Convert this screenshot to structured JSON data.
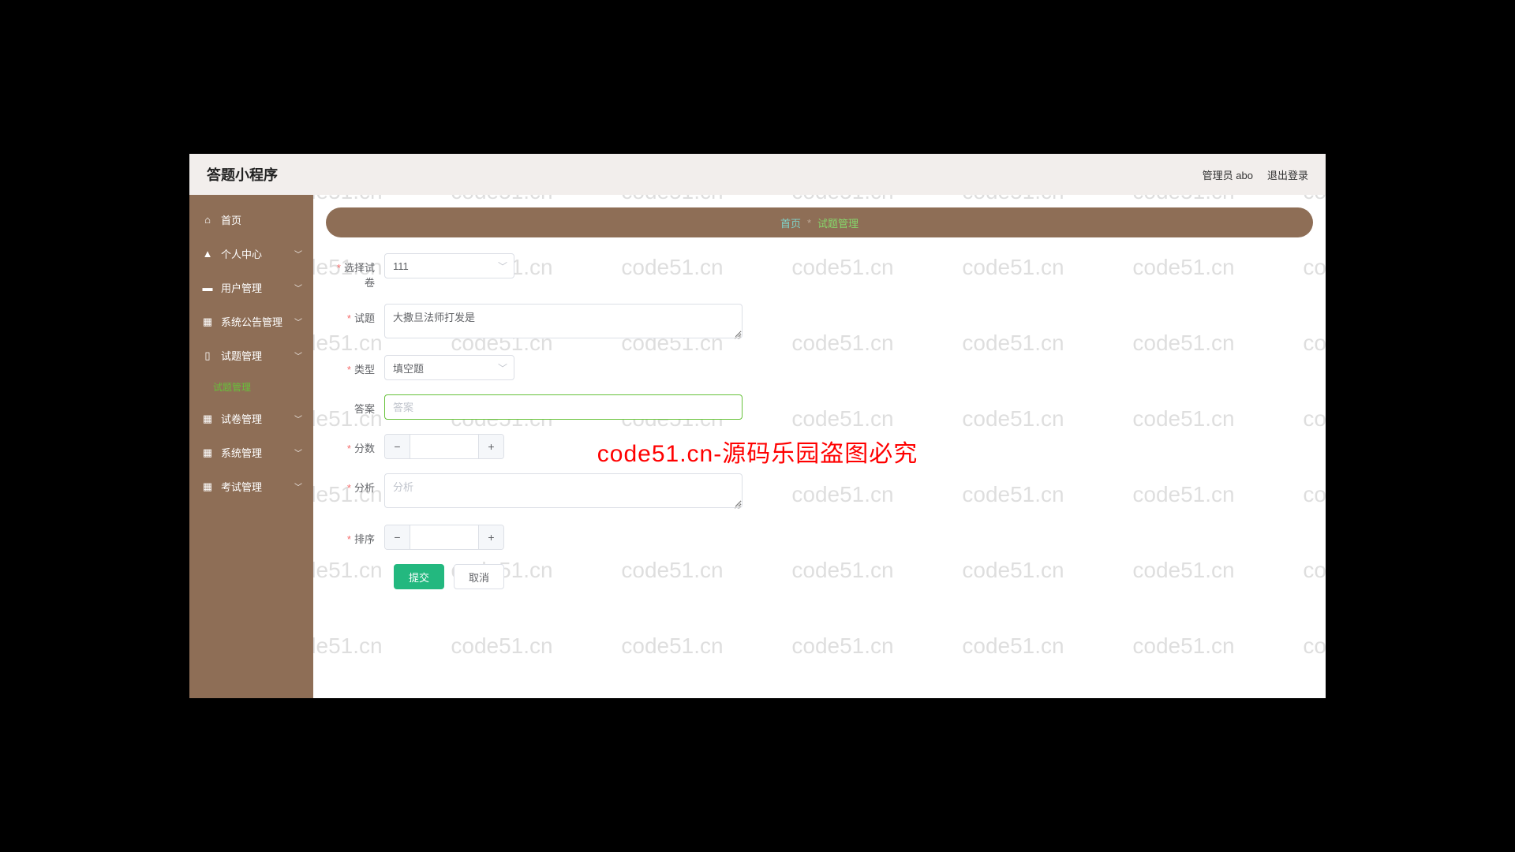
{
  "header": {
    "title": "答题小程序",
    "user": "管理员 abo",
    "logout": "退出登录"
  },
  "sidebar": {
    "items": [
      {
        "label": "首页",
        "expandable": false
      },
      {
        "label": "个人中心",
        "expandable": true
      },
      {
        "label": "用户管理",
        "expandable": true
      },
      {
        "label": "系统公告管理",
        "expandable": true
      },
      {
        "label": "试题管理",
        "expandable": true,
        "sub": "试题管理"
      },
      {
        "label": "试卷管理",
        "expandable": true
      },
      {
        "label": "系统管理",
        "expandable": true
      },
      {
        "label": "考试管理",
        "expandable": true
      }
    ]
  },
  "breadcrumb": {
    "home": "首页",
    "sep": "*",
    "current": "试题管理"
  },
  "form": {
    "select_paper": {
      "label": "选择试卷",
      "value": "111"
    },
    "question": {
      "label": "试题",
      "value": "大撒旦法师打发是"
    },
    "type": {
      "label": "类型",
      "value": "填空题"
    },
    "answer": {
      "label": "答案",
      "placeholder": "答案",
      "value": ""
    },
    "score": {
      "label": "分数",
      "value": ""
    },
    "analysis": {
      "label": "分析",
      "placeholder": "分析",
      "value": ""
    },
    "order": {
      "label": "排序",
      "value": ""
    },
    "submit": "提交",
    "cancel": "取消"
  },
  "watermark": {
    "text": "code51.cn",
    "banner": "code51.cn-源码乐园盗图必究"
  }
}
